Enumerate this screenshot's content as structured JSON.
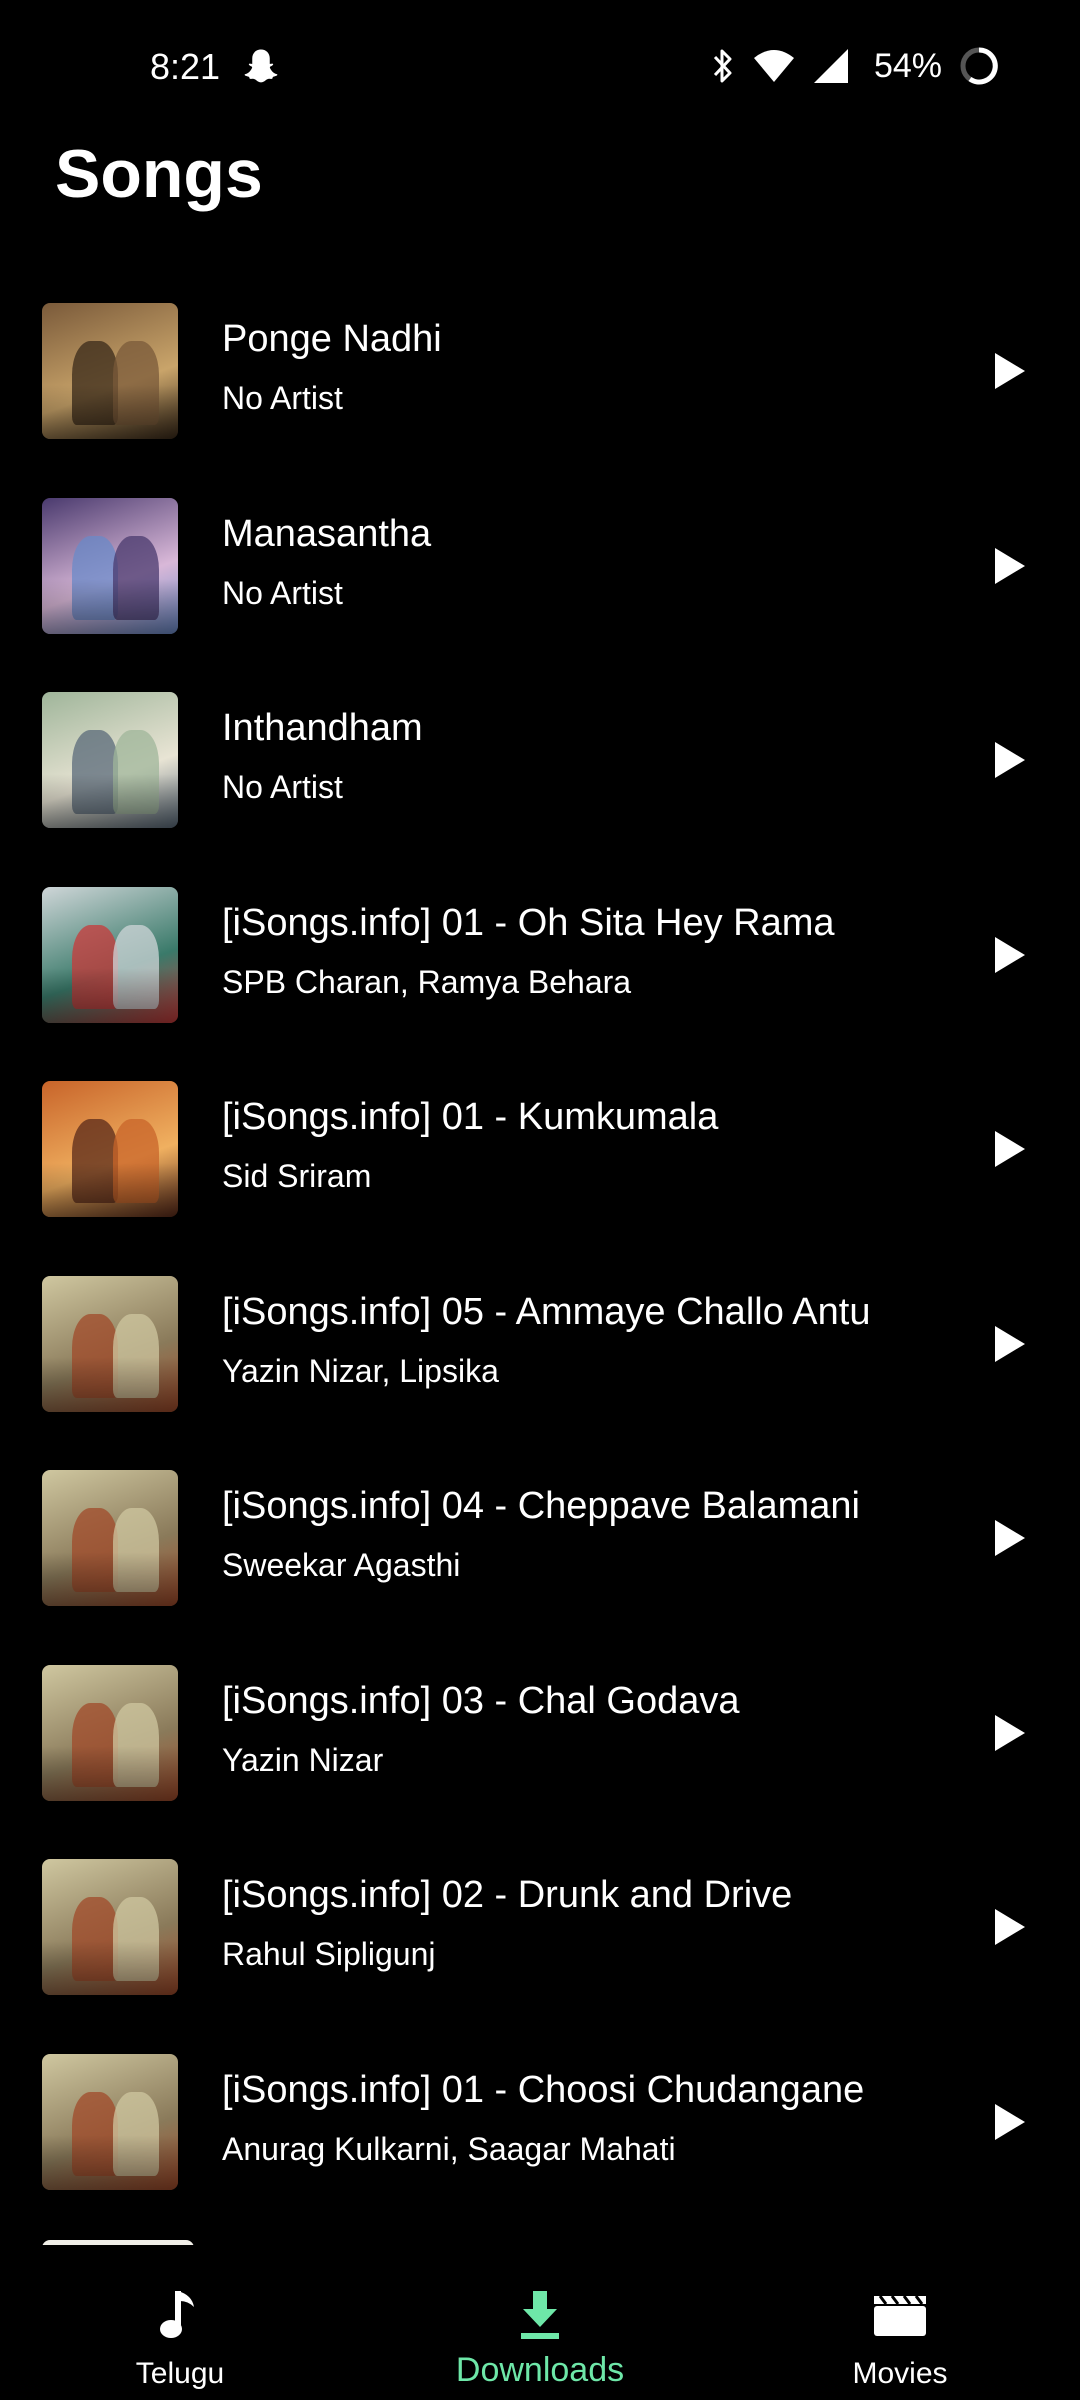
{
  "status_bar": {
    "time": "8:21",
    "battery": "54%",
    "icons": [
      "snapchat-icon",
      "bluetooth-icon",
      "wifi-icon",
      "cellular-signal-icon",
      "battery-icon"
    ]
  },
  "page": {
    "title": "Songs"
  },
  "songs": [
    {
      "title": "Ponge Nadhi",
      "artist": "No Artist",
      "art_colors": [
        "#7a5a3a",
        "#c9a46a",
        "#3a2a1a"
      ]
    },
    {
      "title": "Manasantha",
      "artist": "No Artist",
      "art_colors": [
        "#4a3a6e",
        "#d9b8d8",
        "#6a8ac8"
      ]
    },
    {
      "title": "Inthandham",
      "artist": "No Artist",
      "art_colors": [
        "#9fb59a",
        "#e8e4d4",
        "#5a6a7a"
      ]
    },
    {
      "title": "[iSongs.info] 01 - Oh Sita Hey Rama",
      "artist": "SPB Charan, Ramya Behara",
      "art_colors": [
        "#cfd6d8",
        "#3a7a6a",
        "#c83a3a"
      ]
    },
    {
      "title": "[iSongs.info] 01 - Kumkumala",
      "artist": "Sid Sriram",
      "art_colors": [
        "#c8642a",
        "#f0b060",
        "#5a2a1a"
      ]
    },
    {
      "title": "[iSongs.info] 05 - Ammaye Challo Antu",
      "artist": "Yazin Nizar, Lipsika",
      "art_colors": [
        "#cfc7a0",
        "#8a7a5a",
        "#a04a2a"
      ]
    },
    {
      "title": "[iSongs.info] 04 - Cheppave Balamani",
      "artist": "Sweekar Agasthi",
      "art_colors": [
        "#cfc7a0",
        "#8a7a5a",
        "#a04a2a"
      ]
    },
    {
      "title": "[iSongs.info] 03 - Chal Godava",
      "artist": "Yazin Nizar",
      "art_colors": [
        "#cfc7a0",
        "#8a7a5a",
        "#a04a2a"
      ]
    },
    {
      "title": "[iSongs.info] 02 - Drunk and Drive",
      "artist": "Rahul Sipligunj",
      "art_colors": [
        "#cfc7a0",
        "#8a7a5a",
        "#a04a2a"
      ]
    },
    {
      "title": "[iSongs.info] 01 - Choosi Chudangane",
      "artist": "Anurag Kulkarni, Saagar Mahati",
      "art_colors": [
        "#cfc7a0",
        "#8a7a5a",
        "#a04a2a"
      ]
    }
  ],
  "bottom_nav": {
    "items": [
      {
        "label": "Telugu",
        "icon": "music-note-icon",
        "active": false
      },
      {
        "label": "Downloads",
        "icon": "download-icon",
        "active": true
      },
      {
        "label": "Movies",
        "icon": "clapperboard-icon",
        "active": false
      }
    ],
    "active_color": "#6ee7a8"
  }
}
